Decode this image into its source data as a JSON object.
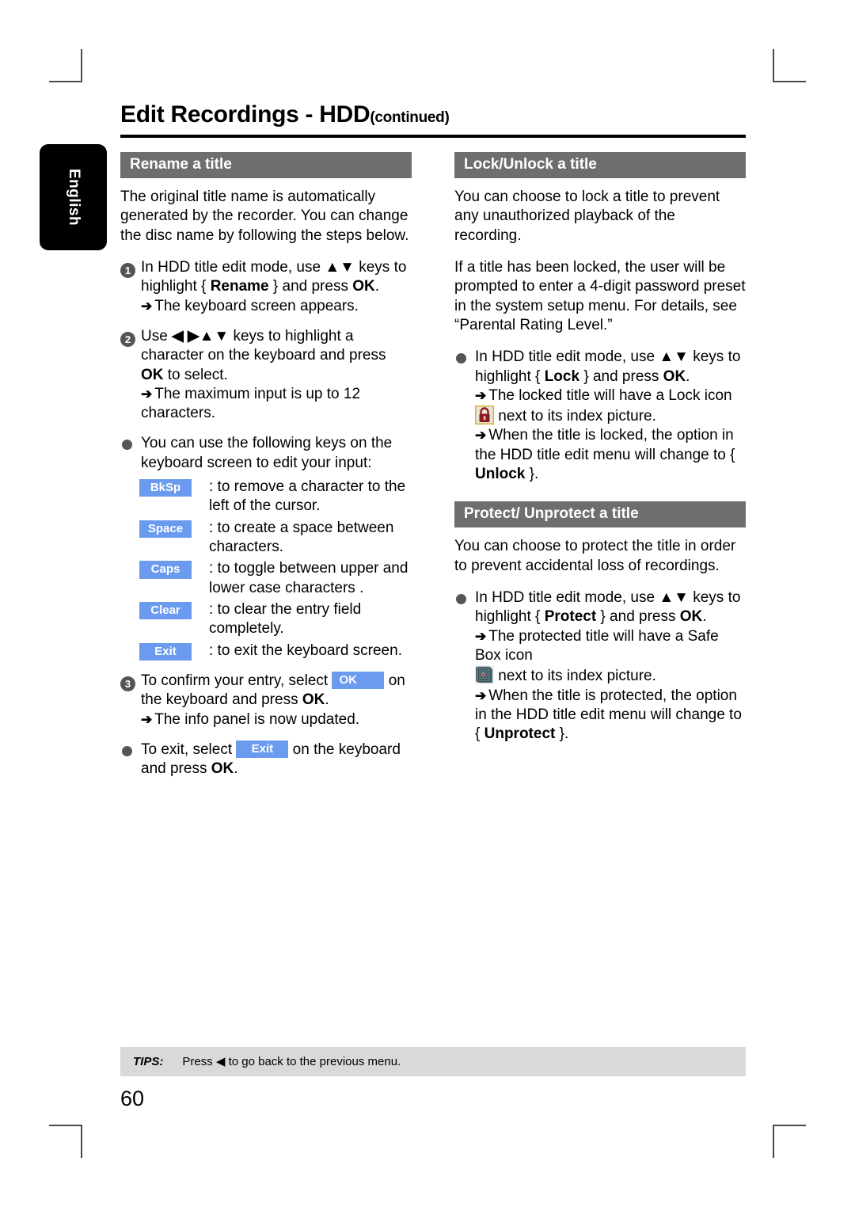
{
  "crop_marks": true,
  "language_tab": {
    "label": "English"
  },
  "header": {
    "title_main": "Edit Recordings - HDD",
    "title_continued": "(continued)"
  },
  "left_column": {
    "section_title": "Rename a title",
    "intro": "The original title name is automatically generated by the recorder. You can change the disc name by following the steps below.",
    "step1": {
      "number": "1",
      "line1_a": "In HDD title edit mode, use ",
      "line1_keys": "▲▼",
      "line1_b": " keys to highlight { ",
      "line1_bold": "Rename",
      "line1_c": " } and press ",
      "line1_bold2": "OK",
      "line1_d": ".",
      "result": "The keyboard screen appears."
    },
    "step2": {
      "number": "2",
      "line1_a": "Use ",
      "line1_keys": "◀ ▶▲▼",
      "line1_b": " keys to highlight a character on the keyboard and press ",
      "line1_bold": "OK",
      "line1_c": " to select.",
      "result": "The maximum input is up to 12 characters."
    },
    "keys_intro": "You can use the following keys on the keyboard screen to edit your input:",
    "keys": [
      {
        "key": "BkSp",
        "desc": ": to remove a character to the left of the cursor."
      },
      {
        "key": "Space",
        "desc": ": to create a space between characters."
      },
      {
        "key": "Caps",
        "desc": ": to toggle between upper and lower case characters ."
      },
      {
        "key": "Clear",
        "desc": ": to clear the entry field completely."
      },
      {
        "key": "Exit",
        "desc": ": to exit the keyboard screen."
      }
    ],
    "step3": {
      "number": "3",
      "line1_a": "To confirm your entry, select ",
      "chip": "OK",
      "line1_b": " on the keyboard and press ",
      "line1_bold": "OK",
      "line1_c": ".",
      "result": "The info panel is now updated."
    },
    "exit_bullet": {
      "line_a": "To exit, select ",
      "chip": "Exit",
      "line_b": " on the keyboard and press ",
      "line_bold": "OK",
      "line_c": "."
    }
  },
  "right_column": {
    "lock_section": {
      "section_title": "Lock/Unlock a title",
      "para1": "You can choose to lock a title to prevent any unauthorized playback of the recording.",
      "para2": "If a title has been locked, the user will be prompted to enter a 4-digit password preset in the system setup menu. For details, see “Parental Rating Level.”",
      "bullet": {
        "line1_a": "In HDD title edit mode, use ",
        "line1_keys": "▲▼",
        "line1_b": " keys to highlight { ",
        "line1_bold": "Lock",
        "line1_c": " } and press ",
        "line1_bold2": "OK",
        "line1_d": ".",
        "result1_a": "The locked title will have a Lock icon",
        "result1_b": " next to its index picture.",
        "result2_a": "When the title is locked, the option in the HDD title edit menu will change to { ",
        "result2_bold": "Unlock",
        "result2_b": " }."
      }
    },
    "protect_section": {
      "section_title": "Protect/ Unprotect a title",
      "para1": "You can choose to protect the title in order to prevent accidental loss of recordings.",
      "bullet": {
        "line1_a": "In HDD title edit mode, use ",
        "line1_keys": "▲▼",
        "line1_b": " keys to highlight { ",
        "line1_bold": "Protect",
        "line1_c": " } and press ",
        "line1_bold2": "OK",
        "line1_d": ".",
        "result1_a": "The protected title will have a Safe Box icon",
        "result1_b": " next to its index picture.",
        "result2_a": "When the title is protected, the option in the HDD title edit menu will change to { ",
        "result2_bold": "Unprotect",
        "result2_b": " }."
      }
    }
  },
  "footer": {
    "tips_label": "TIPS:",
    "tips_text_a": "Press ",
    "tips_arrow": "◀",
    "tips_text_b": " to go back to the previous menu.",
    "page_number": "60"
  },
  "icons": {
    "lock": "lock-icon",
    "safebox": "safe-box-icon"
  },
  "colors": {
    "section_header_bg": "#6e6e6e",
    "key_chip_bg": "#6b9bee",
    "tips_bar_bg": "#d9d9d9",
    "lang_tab_bg": "#000000"
  }
}
